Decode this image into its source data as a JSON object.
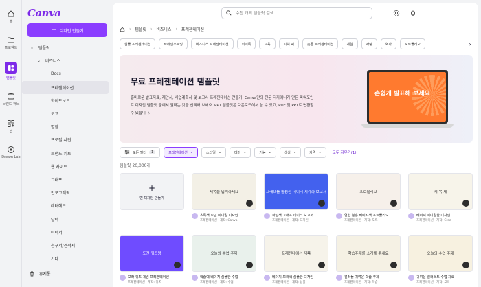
{
  "rail": [
    {
      "label": "홈",
      "icon": "home-icon"
    },
    {
      "label": "프로젝트",
      "icon": "folder-icon"
    },
    {
      "label": "템플릿",
      "icon": "template-icon",
      "active": true
    },
    {
      "label": "브랜드 허브",
      "icon": "brand-icon"
    },
    {
      "label": "앱",
      "icon": "apps-icon"
    },
    {
      "label": "Dream Lab",
      "icon": "dream-lab-icon"
    }
  ],
  "sidebar": {
    "logo": "Canva",
    "create_label": "디자인 만들기",
    "tree": [
      {
        "label": "템플릿",
        "indent": 1,
        "chevron": "open"
      },
      {
        "label": "비즈니스",
        "indent": 2,
        "chevron": "open"
      },
      {
        "label": "Docs",
        "indent": 3
      },
      {
        "label": "프레젠테이션",
        "indent": 3,
        "active": true
      },
      {
        "label": "화이트보드",
        "indent": 3
      },
      {
        "label": "로고",
        "indent": 3
      },
      {
        "label": "명함",
        "indent": 3
      },
      {
        "label": "프로필 사진",
        "indent": 3
      },
      {
        "label": "브랜드 키트",
        "indent": 3
      },
      {
        "label": "웹 사이트",
        "indent": 3
      },
      {
        "label": "그래프",
        "indent": 3
      },
      {
        "label": "인포그래픽",
        "indent": 3
      },
      {
        "label": "레터헤드",
        "indent": 3
      },
      {
        "label": "달력",
        "indent": 3
      },
      {
        "label": "이력서",
        "indent": 3
      },
      {
        "label": "청구서/견적서",
        "indent": 3
      },
      {
        "label": "기타",
        "indent": 3
      }
    ],
    "trash_label": "휴지통"
  },
  "search": {
    "placeholder": "수천 개의 템플릿 검색"
  },
  "breadcrumb": [
    "템플릿",
    "비즈니스",
    "프레젠테이션"
  ],
  "chips": [
    "심플 프레젠테이션",
    "브레인스토밍",
    "비즈니스 프레젠테이션",
    "회의록",
    "교육",
    "피치 덱",
    "숏폼 프레젠테이션",
    "게임",
    "사랑",
    "역사",
    "포트폴리오"
  ],
  "hero": {
    "title": "무료 프레젠테이션 템플릿",
    "desc": "흥미로운 발표자료, 제안서, 사업계획서 및 보고서 프레젠테이션 만들기. Canva만의 전문 디자이너가 만든 파워포인트 디자인 템플릿 중에서 원하는 것을 선택해 보세요. PPT 템플릿은 다운로드해서 쓸 수 있고, PDF 및 PPT로 변환할 수 있습니다.",
    "promo": "손쉽게 발표해 보세요"
  },
  "filters": {
    "all_label": "모든 필터",
    "all_count": "1",
    "items": [
      {
        "label": "프레젠테이션",
        "selected": true
      },
      {
        "label": "스타일"
      },
      {
        "label": "테마"
      },
      {
        "label": "기능"
      },
      {
        "label": "색상"
      },
      {
        "label": "가격"
      }
    ],
    "clear_label": "모두 지우기(1)"
  },
  "result_count": "템플릿 20,000개",
  "blank_card_label": "빈 디자인 만들기",
  "cards": [
    {
      "thumb_text": "제목을 입력하세요",
      "bg": "#f3f0e6",
      "title": "초록색 모던 미니멀 디자인",
      "sub": "프레젠테이션 · 제작: Canva"
    },
    {
      "thumb_text": "그래프를 활용한 데이터 시각화 보고서",
      "bg": "#4361ee",
      "title": "파란색 그래프 데이터 보고서",
      "sub": "프레젠테이션 · 제작: 디자인"
    },
    {
      "thumb_text": "프로필리오",
      "bg": "#f6f0ea",
      "title": "연한 분홍 베이지색 포트폴리오",
      "sub": "프레젠테이션 · 제작: 포트"
    },
    {
      "thumb_text": "제 목 제",
      "bg": "#f7f4ea",
      "title": "베이지 미니멀한 디자인",
      "sub": "프레젠테이션 · 제작: Crea"
    },
    {
      "thumb_text": "도전 퀴즈왕",
      "bg": "#6f4cff",
      "title": "보라 퀴즈 게임 프레젠테이션",
      "sub": "프레젠테이션 · 제작: 퀴즈"
    },
    {
      "thumb_text": "오늘의 수업 주제",
      "bg": "#e9f1ec",
      "title": "학습에 베이지 심플한 수업",
      "sub": "프레젠테이션 · 제작: 수업"
    },
    {
      "thumb_text": "프레젠테이션 제목",
      "bg": "#f6f3ea",
      "title": "베이지 보라색 심플한 디자인",
      "sub": "프레젠테이션 · 제작: 심플"
    },
    {
      "thumb_text": "학습주제를 소개해 주세요",
      "bg": "#f5f1e4",
      "title": "컬러풀 귀여운 학습 주제",
      "sub": "프레젠테이션 · 제작: 학습"
    },
    {
      "thumb_text": "오늘의 수업 주제",
      "bg": "#f7f1e0",
      "title": "귀여운 일러스트 수업 자료",
      "sub": "프레젠테이션 · 제작: 교육"
    }
  ],
  "colors": {
    "brand": "#8b3dff",
    "logo": "#7d2ae8"
  }
}
